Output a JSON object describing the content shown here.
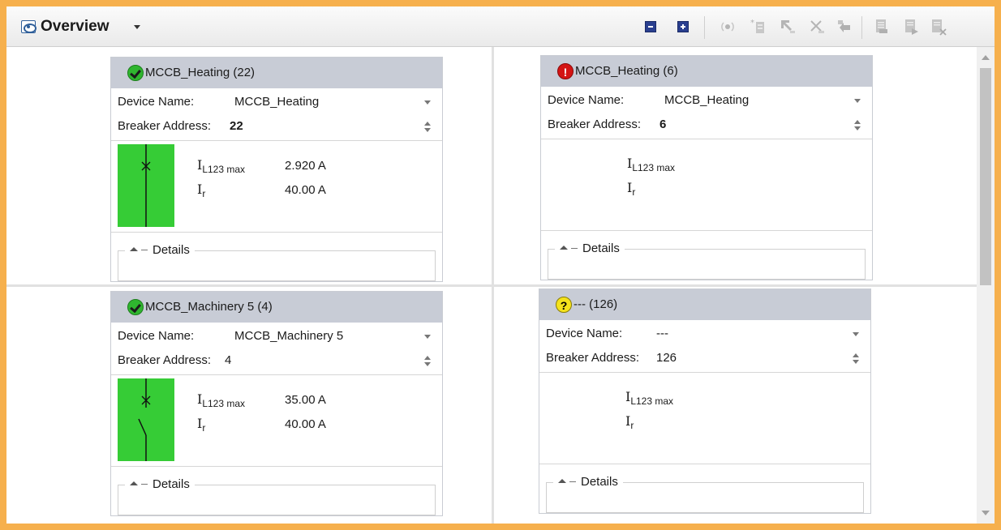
{
  "toolbar": {
    "title": "Overview",
    "buttons": [
      {
        "name": "collapse-all",
        "icon": "minus-square-icon"
      },
      {
        "name": "expand-all",
        "icon": "plus-square-icon"
      },
      {
        "name": "signal",
        "icon": "signal-icon"
      },
      {
        "name": "new-device",
        "icon": "new-device-icon"
      },
      {
        "name": "upload",
        "icon": "upload-icon"
      },
      {
        "name": "delete",
        "icon": "delete-icon"
      },
      {
        "name": "download",
        "icon": "download-icon"
      },
      {
        "name": "doc-1",
        "icon": "document-icon"
      },
      {
        "name": "doc-2",
        "icon": "document-arrow-icon"
      },
      {
        "name": "doc-3",
        "icon": "document-x-icon"
      }
    ]
  },
  "labels": {
    "device_name": "Device Name:",
    "breaker_address": "Breaker Address:",
    "i_main": "I",
    "i_main_sub": "L123 max",
    "ir_main": "I",
    "ir_sub": "r",
    "details": "Details"
  },
  "cards": [
    {
      "header": "MCCB_Heating (22)",
      "status": "ok",
      "device_name": "MCCB_Heating",
      "breaker_address": "22",
      "address_bold": true,
      "breaker_state": "closed",
      "i_l123_max": "2.920 A",
      "i_r": "40.00 A"
    },
    {
      "header": "MCCB_Heating (6)",
      "status": "error",
      "device_name": "MCCB_Heating",
      "breaker_address": "6",
      "address_bold": true,
      "breaker_state": "none",
      "i_l123_max": "",
      "i_r": ""
    },
    {
      "header": "MCCB_Machinery 5 (4)",
      "status": "ok",
      "device_name": "MCCB_Machinery 5",
      "breaker_address": "4",
      "address_bold": false,
      "breaker_state": "open",
      "i_l123_max": "35.00 A",
      "i_r": "40.00 A"
    },
    {
      "header": "--- (126)",
      "status": "unknown",
      "device_name": "---",
      "breaker_address": "126",
      "address_bold": false,
      "breaker_state": "none",
      "i_l123_max": "",
      "i_r": ""
    }
  ],
  "colors": {
    "frame": "#f6b04d",
    "card_header": "#c8ccd6",
    "breaker_green": "#36cc36",
    "status_ok": "#2fb52f",
    "status_error": "#d41414",
    "status_unknown": "#f4e21c"
  }
}
